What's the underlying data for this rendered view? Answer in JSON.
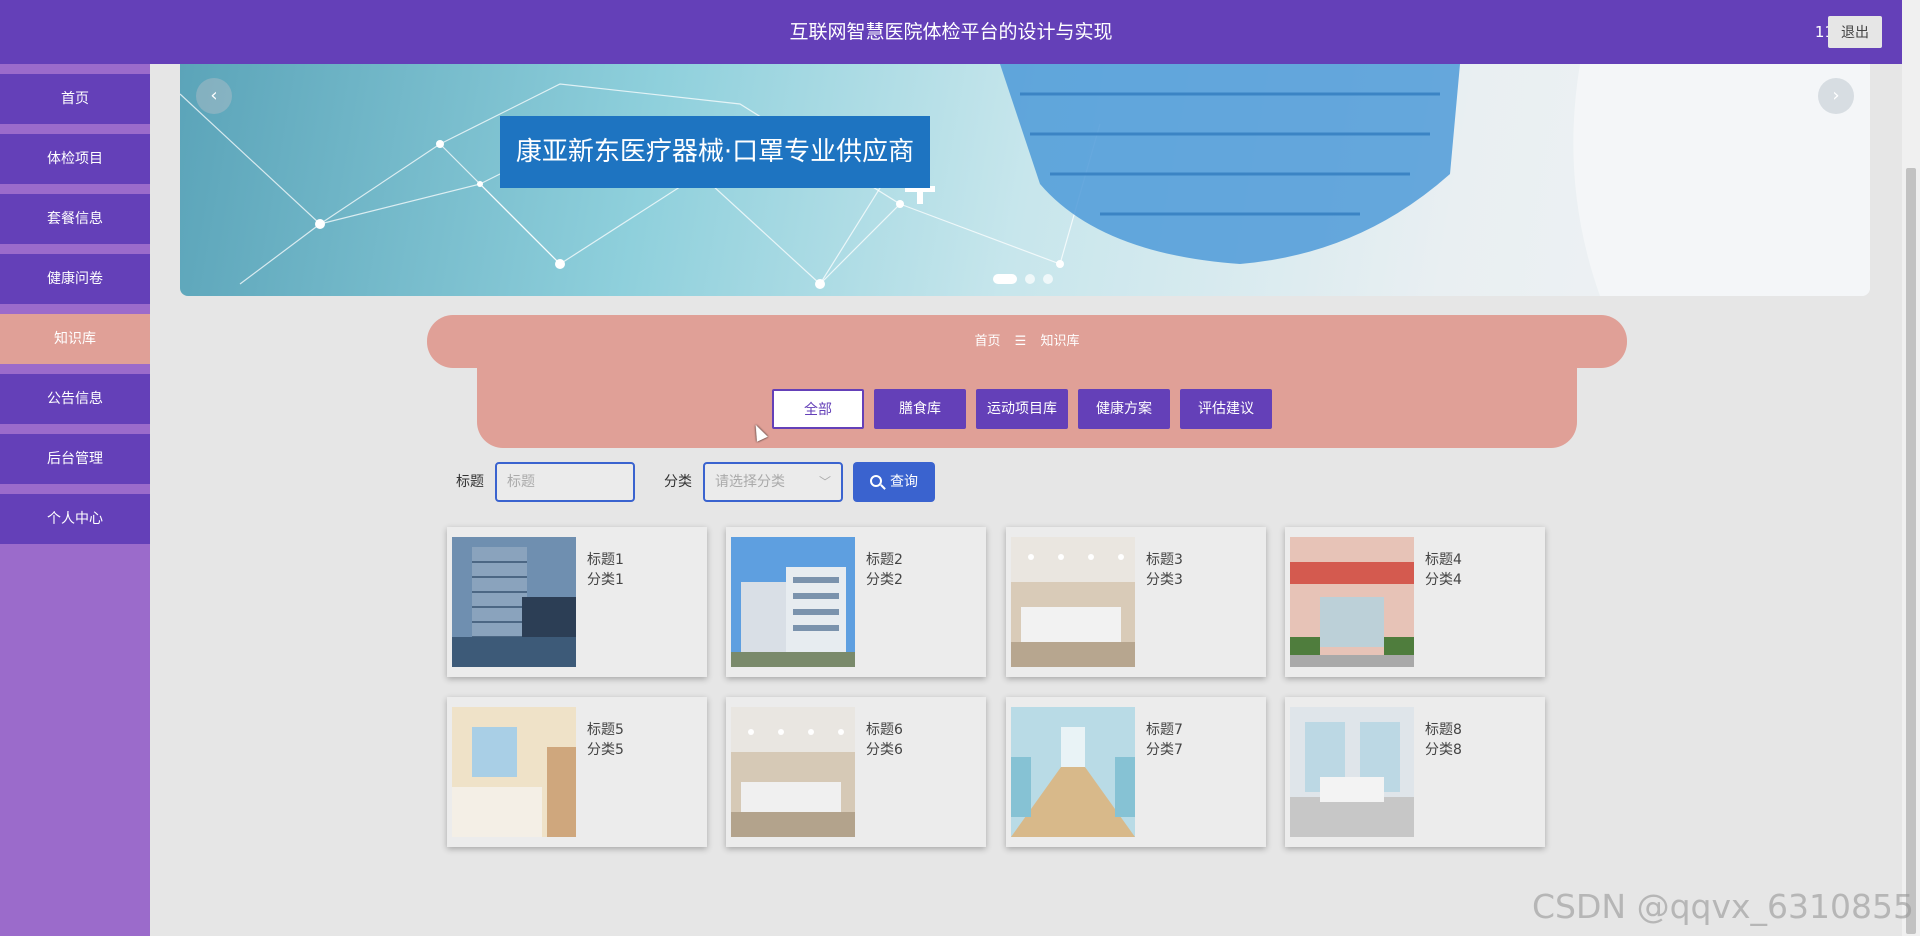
{
  "header": {
    "title": "互联网智慧医院体检平台的设计与实现",
    "user": "11",
    "logout_label": "退出"
  },
  "sidebar": {
    "items": [
      {
        "label": "首页"
      },
      {
        "label": "体检项目"
      },
      {
        "label": "套餐信息"
      },
      {
        "label": "健康问卷"
      },
      {
        "label": "知识库",
        "active": true
      },
      {
        "label": "公告信息"
      },
      {
        "label": "后台管理"
      },
      {
        "label": "个人中心"
      }
    ]
  },
  "banner": {
    "caption": "康亚新东医疗器械·口罩专业供应商",
    "prev_icon": "‹",
    "next_icon": "›"
  },
  "breadcrumb": {
    "home": "首页",
    "separator": "☰",
    "current": "知识库"
  },
  "categories": [
    "全部",
    "膳食库",
    "运动项目库",
    "健康方案",
    "评估建议"
  ],
  "search": {
    "title_label": "标题",
    "title_placeholder": "标题",
    "category_label": "分类",
    "category_placeholder": "请选择分类",
    "query_label": "查询"
  },
  "cards": [
    {
      "title": "标题1",
      "category": "分类1"
    },
    {
      "title": "标题2",
      "category": "分类2"
    },
    {
      "title": "标题3",
      "category": "分类3"
    },
    {
      "title": "标题4",
      "category": "分类4"
    },
    {
      "title": "标题5",
      "category": "分类5"
    },
    {
      "title": "标题6",
      "category": "分类6"
    },
    {
      "title": "标题7",
      "category": "分类7"
    },
    {
      "title": "标题8",
      "category": "分类8"
    }
  ],
  "watermark": "CSDN @qqvx_6310855",
  "colors": {
    "primary": "#6440b8",
    "accent": "#e0a097",
    "sidebar_bg": "#9b6bcb",
    "button_blue": "#3a63cf"
  }
}
